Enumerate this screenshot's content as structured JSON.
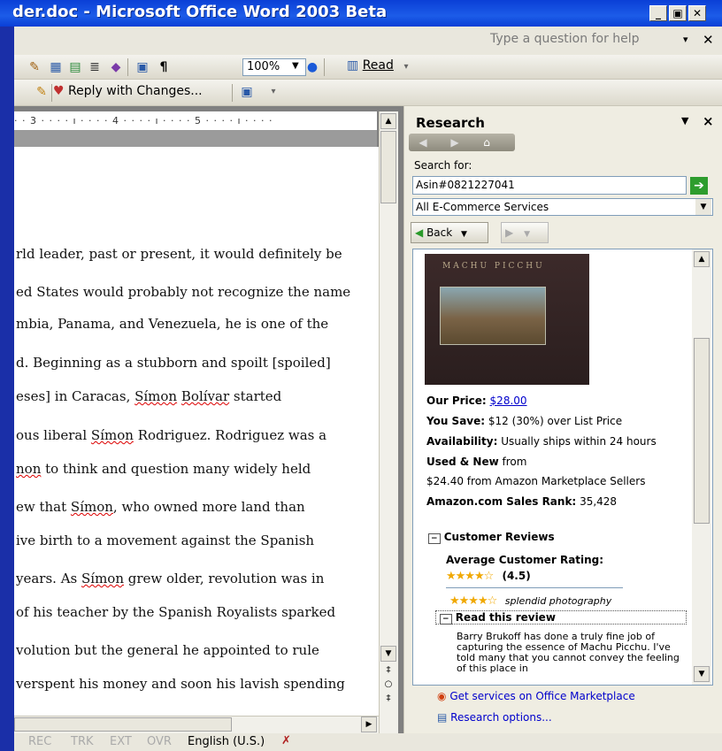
{
  "window": {
    "title": "der.doc - Microsoft Office Word 2003 Beta",
    "min_label": "_",
    "max_label": "▣",
    "close_label": "✕"
  },
  "menubar": {
    "help_placeholder": "Type a question for help",
    "help_dropdown": "▾",
    "help_close": "✕"
  },
  "toolbar": {
    "zoom": "100%",
    "read_label": "Read",
    "reply_label": "Reply with Changes..."
  },
  "document": {
    "ruler_text": "· · 3 · · · · ı · · · · 4 · · · · ı · · · · 5 · · · · ı · · · ·",
    "lines": [
      "rld leader, past or present, it would definitely be",
      "ed States would probably not recognize the name",
      "mbia, Panama, and Venezuela, he is one of the",
      "d. Beginning as a stubborn and spoilt [spoiled]",
      "eses] in Caracas, Símon Bolívar started",
      "ous liberal Símon Rodriguez. Rodriguez was a",
      "non to think and question many widely held",
      "ew that Símon, who owned more land than",
      "ive birth to a movement against the Spanish",
      " years. As Símon grew older, revolution was in",
      "of his teacher by the Spanish Royalists sparked",
      "volution but the general he appointed to rule",
      "verspent his money and soon his lavish spending"
    ]
  },
  "status": {
    "rec": "REC",
    "trk": "TRK",
    "ext": "EXT",
    "ovr": "OVR",
    "language": "English (U.S.)"
  },
  "research": {
    "title": "Research",
    "search_for_label": "Search for:",
    "search_value": "Asin#0821227041",
    "service": "All E-Commerce Services",
    "back_label": "Back",
    "book_title": "MACHU PICCHU",
    "price_label": "Our Price:",
    "price_value": "$28.00",
    "save_label": "You Save:",
    "save_value": "$12 (30%) over List Price",
    "availability_label": "Availability:",
    "availability_value": "Usually ships within 24 hours",
    "used_label": "Used & New",
    "used_from": "from",
    "used_value": "$24.40 from Amazon Marketplace Sellers",
    "rank_label": "Amazon.com Sales Rank:",
    "rank_value": "35,428",
    "reviews_header": "Customer Reviews",
    "avg_rating_label": "Average Customer Rating:",
    "avg_rating_value": "(4.5)",
    "rating_stars": 4.5,
    "review_stars": 4,
    "review_title": "splendid photography",
    "read_review": "Read this review",
    "review_text": "Barry Brukoff has done a truly fine job of capturing the essence of Machu Picchu. I've told many that you cannot convey the feeling of this place in",
    "marketplace_link": "Get services on Office Marketplace",
    "options_link": "Research options..."
  }
}
